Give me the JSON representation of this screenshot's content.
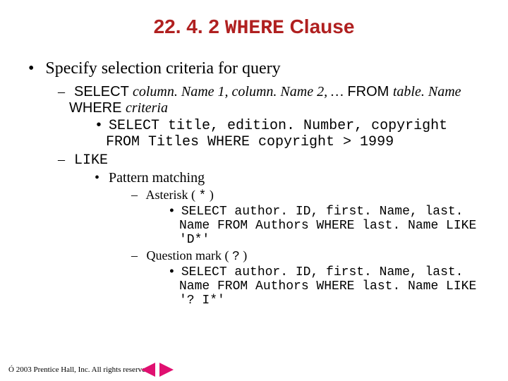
{
  "title": {
    "num": "22. 4. 2 ",
    "kw": "WHERE",
    "rest": " Clause"
  },
  "b1": "Specify selection criteria for query",
  "sel": {
    "kw": "SELECT ",
    "cols": "column. Name 1, column. Name 2, …",
    "from": " FROM ",
    "tbl": "table. Name"
  },
  "whr": {
    "kw": "WHERE ",
    "crit": "criteria"
  },
  "ex1": "SELECT title, edition. Number, copyright FROM Titles WHERE copyright > 1999",
  "like": "LIKE",
  "pm": "Pattern matching",
  "ast": {
    "pre": "Asterisk ( ",
    "sym": "*",
    "post": " )"
  },
  "ex2": "SELECT author. ID, first. Name, last. Name FROM Authors WHERE last. Name LIKE 'D*'",
  "qm": {
    "pre": "Question mark ( ",
    "sym": "?",
    "post": " )"
  },
  "ex3": "SELECT author. ID, first. Name, last. Name FROM Authors WHERE last. Name LIKE '? I*'",
  "footer": {
    "copy": "Ó",
    "text": " 2003 Prentice Hall, Inc. All rights reserved."
  }
}
